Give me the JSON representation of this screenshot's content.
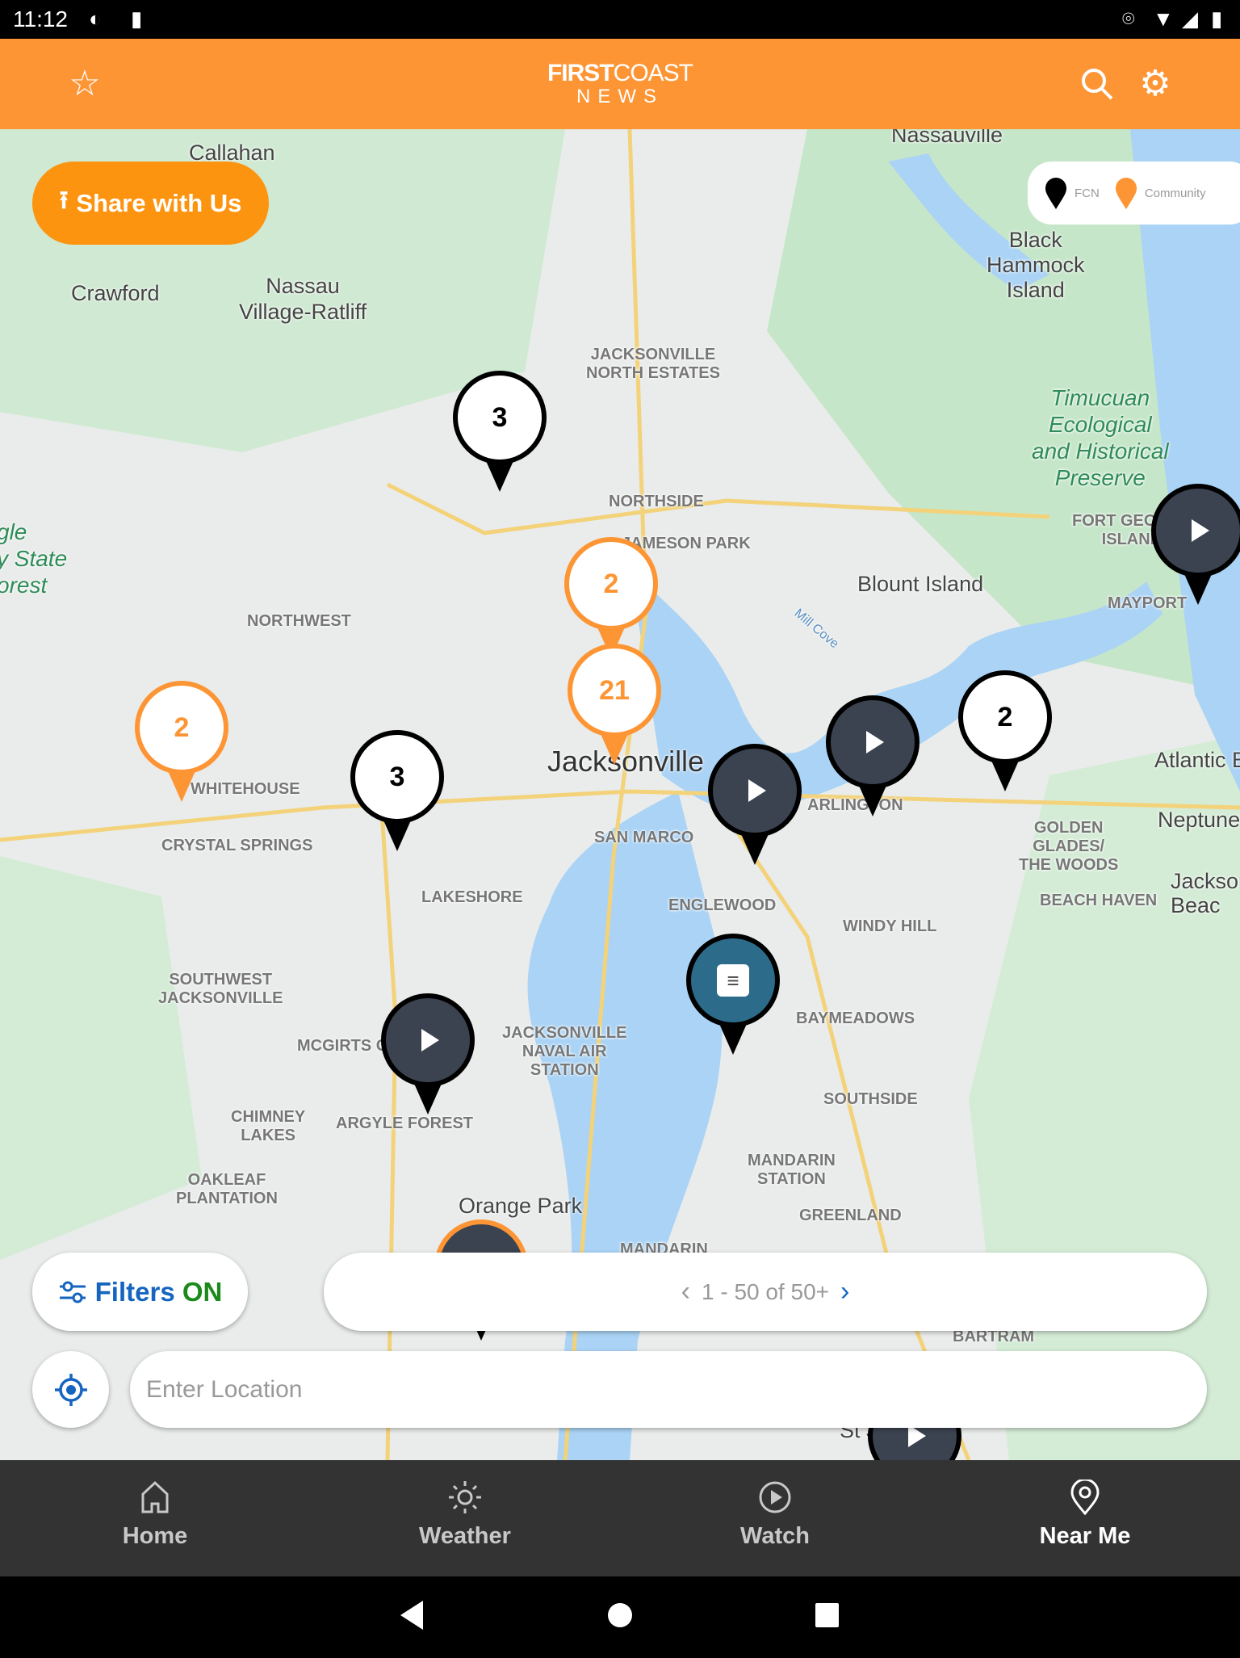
{
  "status_bar": {
    "time": "11:12"
  },
  "header": {
    "logo_line1_bold": "FIRST",
    "logo_line1_light": "COAST",
    "logo_line2": "NEWS",
    "favorite_icon": "star-icon",
    "search_icon": "search-icon",
    "settings_icon": "gear-icon"
  },
  "map": {
    "share_button": "Share with Us",
    "legend": {
      "fcn": "FCN",
      "community": "Community",
      "fcn_color": "#000000",
      "community_color": "#fd9535"
    },
    "labels": {
      "callahan": "Callahan",
      "nassauville": "Nassauville",
      "crawford": "Crawford",
      "nassau_village": "Nassau\nVillage-Ratliff",
      "black_hammock": "Black\nHammock\nIsland",
      "jax_north_estates": "JACKSONVILLE\nNORTH ESTATES",
      "timucuan": "Timucuan\nEcological\nand Historical\nPreserve",
      "northside": "NORTHSIDE",
      "jameson_park": "JAMESON PARK",
      "fort_george": "FORT GEORGE\nISLAND",
      "blount_island": "Blount Island",
      "mayport": "MAYPORT",
      "northwest": "NORTHWEST",
      "state_forest": "gle\ny State\norest",
      "mill_cove": "Mill Cove",
      "jacksonville": "Jacksonville",
      "whitehouse": "WHITEHOUSE",
      "arlington": "ARLINGTON",
      "atlantic_beach": "Atlantic B",
      "neptune": "Neptune",
      "crystal_springs": "CRYSTAL SPRINGS",
      "san_marco": "SAN MARCO",
      "golden_glades": "GOLDEN\nGLADES/\nTHE WOODS",
      "jax_beach": "Jackson\nBeac",
      "lakeshore": "LAKESHORE",
      "englewood": "ENGLEWOOD",
      "beach_haven": "BEACH HAVEN",
      "windy_hill": "WINDY HILL",
      "southwest_jax": "SOUTHWEST\nJACKSONVILLE",
      "baymeadows": "BAYMEADOWS",
      "mcgirts": "MCGIRTS C",
      "naval_air": "JACKSONVILLE\nNAVAL AIR\nSTATION",
      "chimney_lakes": "CHIMNEY\nLAKES",
      "argyle_forest": "ARGYLE FOREST",
      "southside": "SOUTHSIDE",
      "oakleaf": "OAKLEAF\nPLANTATION",
      "mandarin_station": "MANDARIN\nSTATION",
      "orange_park": "Orange Park",
      "greenland": "GREENLAND",
      "mandarin": "MANDARIN",
      "bartram": "BARTRAM",
      "st_johns": "St Johns"
    },
    "pins": [
      {
        "type": "fcn",
        "count": "3"
      },
      {
        "type": "community",
        "count": "2"
      },
      {
        "type": "community",
        "count": "21"
      },
      {
        "type": "community",
        "count": "2"
      },
      {
        "type": "fcn",
        "count": "3"
      },
      {
        "type": "fcn",
        "count": "2"
      },
      {
        "type": "fcn-video"
      },
      {
        "type": "fcn-video"
      },
      {
        "type": "fcn-video"
      },
      {
        "type": "fcn-article"
      },
      {
        "type": "fcn-video"
      }
    ],
    "filters": {
      "label": "Filters",
      "state": "ON"
    },
    "pager": {
      "text": "1 - 50 of 50+"
    },
    "location_input": {
      "placeholder": "Enter Location",
      "value": ""
    }
  },
  "bottom_nav": [
    {
      "label": "Home",
      "icon": "home-icon",
      "active": false
    },
    {
      "label": "Weather",
      "icon": "sun-icon",
      "active": false
    },
    {
      "label": "Watch",
      "icon": "play-circle-icon",
      "active": false
    },
    {
      "label": "Near Me",
      "icon": "location-pin-icon",
      "active": true
    }
  ]
}
